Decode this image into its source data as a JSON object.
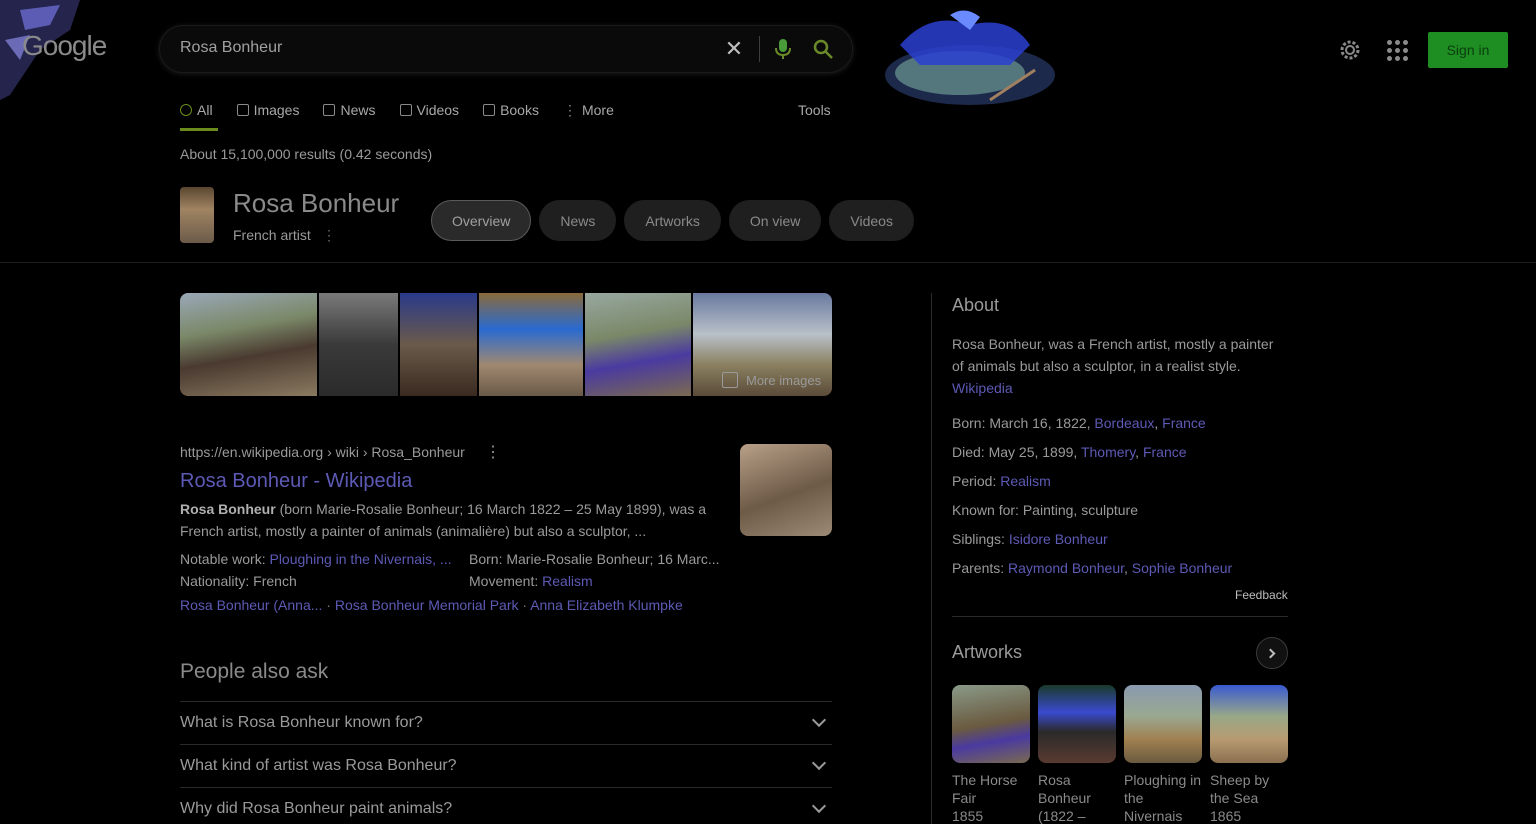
{
  "header": {
    "logo_text": "Google",
    "search_value": "Rosa Bonheur",
    "signin_label": "Sign in",
    "accent_color": "#1e8e22"
  },
  "tabs": [
    {
      "label": "All",
      "icon": "search-icon",
      "active": true
    },
    {
      "label": "Images",
      "icon": "image-icon"
    },
    {
      "label": "News",
      "icon": "news-icon"
    },
    {
      "label": "Videos",
      "icon": "video-icon"
    },
    {
      "label": "Books",
      "icon": "book-icon"
    },
    {
      "label": "More",
      "icon": "more-icon"
    }
  ],
  "tools_label": "Tools",
  "result_stats": "About 15,100,000 results (0.42 seconds)",
  "entity": {
    "name": "Rosa Bonheur",
    "subtitle": "French artist",
    "chips": [
      "Overview",
      "News",
      "Artworks",
      "On view",
      "Videos"
    ]
  },
  "images": {
    "more_label": "More images"
  },
  "result": {
    "url": "https://en.wikipedia.org › wiki › Rosa_Bonheur",
    "title": "Rosa Bonheur - Wikipedia",
    "snippet_bold": "Rosa Bonheur",
    "snippet_rest": " (born Marie-Rosalie Bonheur; 16 March 1822 – 25 May 1899), was a French artist, mostly a painter of animals (animalière) but also a sculptor, ...",
    "facts": [
      {
        "label": "Notable work: ",
        "value": "Ploughing in the Nivernais, ...",
        "is_link": true
      },
      {
        "label": "Born: ",
        "value": "Marie-Rosalie Bonheur; 16 Marc...",
        "is_link": false
      },
      {
        "label": "Nationality: ",
        "value": "French",
        "is_link": false
      },
      {
        "label": "Movement: ",
        "value": "Realism",
        "is_link": true
      }
    ],
    "sitelinks": [
      "Rosa Bonheur (Anna...",
      "Rosa Bonheur Memorial Park",
      "Anna Elizabeth Klumpke"
    ]
  },
  "paa": {
    "title": "People also ask",
    "questions": [
      "What is Rosa Bonheur known for?",
      "What kind of artist was Rosa Bonheur?",
      "Why did Rosa Bonheur paint animals?"
    ]
  },
  "kp": {
    "about_title": "About",
    "description": "Rosa Bonheur, was a French artist, mostly a painter of animals but also a sculptor, in a realist style.",
    "source": "Wikipedia",
    "facts": [
      {
        "label": "Born: ",
        "text": "March 16, 1822, ",
        "links": [
          "Bordeaux",
          "France"
        ]
      },
      {
        "label": "Died: ",
        "text": "May 25, 1899, ",
        "links": [
          "Thomery",
          "France"
        ]
      },
      {
        "label": "Period: ",
        "text": "",
        "links": [
          "Realism"
        ]
      },
      {
        "label": "Known for: ",
        "text": "Painting, sculpture",
        "links": []
      },
      {
        "label": "Siblings: ",
        "text": "",
        "links": [
          "Isidore Bonheur"
        ]
      },
      {
        "label": "Parents: ",
        "text": "",
        "links": [
          "Raymond Bonheur",
          "Sophie Bonheur"
        ]
      }
    ],
    "feedback": "Feedback",
    "artworks_title": "Artworks",
    "artworks": [
      {
        "title": "The Horse Fair",
        "year": "1855"
      },
      {
        "title": "Rosa Bonheur (1822 –",
        "year": ""
      },
      {
        "title": "Ploughing in the Nivernais",
        "year": ""
      },
      {
        "title": "Sheep by the Sea",
        "year": "1865"
      }
    ]
  }
}
